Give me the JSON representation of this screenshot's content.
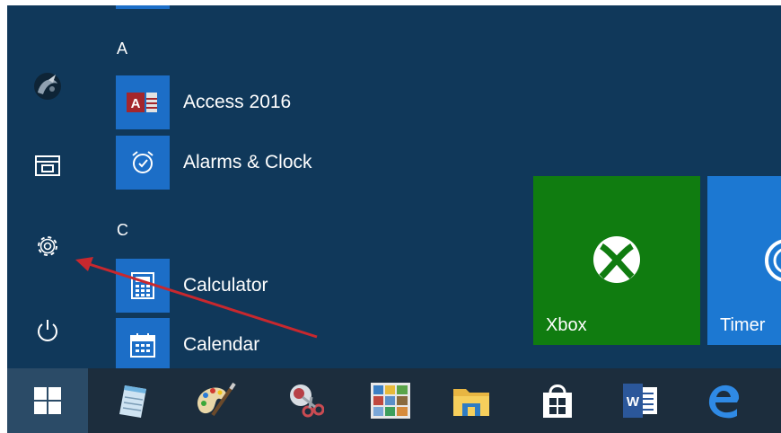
{
  "start_menu": {
    "sections": [
      {
        "letter": "A",
        "apps": [
          {
            "label": "Access 2016",
            "icon": "access-icon"
          },
          {
            "label": "Alarms & Clock",
            "icon": "alarm-clock-icon"
          }
        ]
      },
      {
        "letter": "C",
        "apps": [
          {
            "label": "Calculator",
            "icon": "calculator-icon"
          },
          {
            "label": "Calendar",
            "icon": "calendar-icon"
          }
        ]
      }
    ],
    "rail": [
      "user-avatar-icon",
      "file-explorer-icon",
      "settings-icon",
      "power-icon"
    ],
    "tiles": [
      {
        "label": "Xbox",
        "icon": "xbox-icon",
        "color": "#107c10"
      },
      {
        "label": "Timer",
        "icon": "timer-icon",
        "color": "#1c78d2"
      }
    ]
  },
  "taskbar": {
    "items": [
      "windows-start-icon",
      "notepad-icon",
      "paint-icon",
      "snipping-tool-icon",
      "photos-icon",
      "file-explorer-icon",
      "store-icon",
      "word-icon",
      "edge-icon"
    ]
  },
  "colors": {
    "background": "#10385a",
    "app_icon_blue": "#1c6ec7",
    "taskbar": "#1c2d3d",
    "annotation_arrow": "#c8282e"
  }
}
